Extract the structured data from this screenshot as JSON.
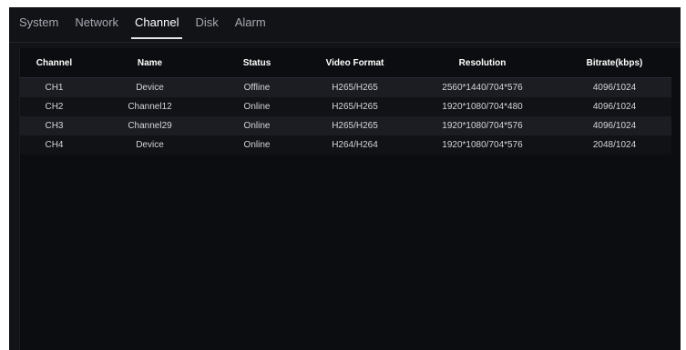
{
  "tabs": [
    {
      "label": "System",
      "active": false
    },
    {
      "label": "Network",
      "active": false
    },
    {
      "label": "Channel",
      "active": true
    },
    {
      "label": "Disk",
      "active": false
    },
    {
      "label": "Alarm",
      "active": false
    }
  ],
  "table": {
    "columns": [
      "Channel",
      "Name",
      "Status",
      "Video Format",
      "Resolution",
      "Bitrate(kbps)"
    ],
    "rows": [
      [
        "CH1",
        "Device",
        "Offline",
        "H265/H265",
        "2560*1440/704*576",
        "4096/1024"
      ],
      [
        "CH2",
        "Channel12",
        "Online",
        "H265/H265",
        "1920*1080/704*480",
        "4096/1024"
      ],
      [
        "CH3",
        "Channel29",
        "Online",
        "H265/H265",
        "1920*1080/704*576",
        "4096/1024"
      ],
      [
        "CH4",
        "Device",
        "Online",
        "H264/H264",
        "1920*1080/704*576",
        "2048/1024"
      ]
    ]
  }
}
